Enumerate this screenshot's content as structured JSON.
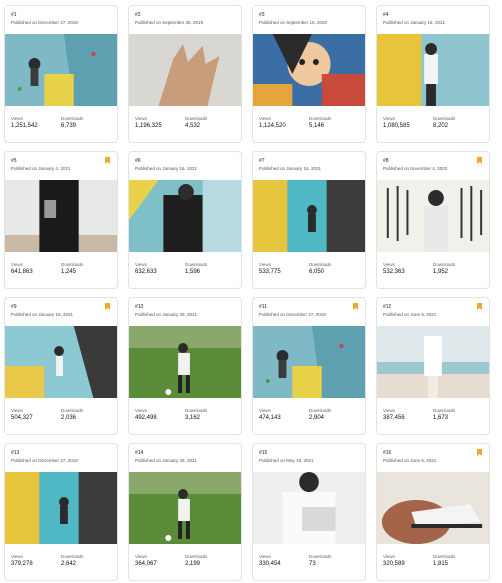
{
  "labels": {
    "views": "Views",
    "downloads": "Downloads"
  },
  "colors": {
    "bookmark": "#f0a92c",
    "border": "#e3e3e3"
  },
  "cards": [
    {
      "rank": "#1",
      "published": "Published on December 27, 2019",
      "views": "1,251,542",
      "downloads": "6,739",
      "bookmarked": false,
      "photo": "climbing-wall"
    },
    {
      "rank": "#2",
      "published": "Published on September 30, 2019",
      "views": "1,196,325",
      "downloads": "4,532",
      "bookmarked": false,
      "photo": "hand"
    },
    {
      "rank": "#3",
      "published": "Published on September 10, 2020",
      "views": "1,124,520",
      "downloads": "5,146",
      "bookmarked": false,
      "photo": "mural"
    },
    {
      "rank": "#4",
      "published": "Published on January 16, 2021",
      "views": "1,080,585",
      "downloads": "8,202",
      "bookmarked": false,
      "photo": "climber-yellow"
    },
    {
      "rank": "#5",
      "published": "Published on January 4, 2021",
      "views": "641,863",
      "downloads": "1,245",
      "bookmarked": true,
      "photo": "person-black"
    },
    {
      "rank": "#6",
      "published": "Published on January 16, 2021",
      "views": "632,633",
      "downloads": "1,596",
      "bookmarked": false,
      "photo": "climber-harness"
    },
    {
      "rank": "#7",
      "published": "Published on January 16, 2021",
      "views": "533,775",
      "downloads": "6,050",
      "bookmarked": false,
      "photo": "climber-teal"
    },
    {
      "rank": "#8",
      "published": "Published on November 4, 2020",
      "views": "532,363",
      "downloads": "1,952",
      "bookmarked": true,
      "photo": "calligraphy"
    },
    {
      "rank": "#9",
      "published": "Published on January 16, 2021",
      "views": "504,327",
      "downloads": "2,036",
      "bookmarked": true,
      "photo": "climber-reach"
    },
    {
      "rank": "#10",
      "published": "Published on January 28, 2021",
      "views": "492,498",
      "downloads": "3,162",
      "bookmarked": false,
      "photo": "soccer"
    },
    {
      "rank": "#11",
      "published": "Published on December 27, 2019",
      "views": "474,143",
      "downloads": "2,904",
      "bookmarked": true,
      "photo": "climbing-wall"
    },
    {
      "rank": "#12",
      "published": "Published on June 9, 2021",
      "views": "387,456",
      "downloads": "1,673",
      "bookmarked": true,
      "photo": "beach"
    },
    {
      "rank": "#13",
      "published": "Published on December 27, 2019",
      "views": "379,278",
      "downloads": "2,642",
      "bookmarked": false,
      "photo": "climber-teal"
    },
    {
      "rank": "#14",
      "published": "Published on January 28, 2021",
      "views": "364,067",
      "downloads": "2,199",
      "bookmarked": false,
      "photo": "soccer"
    },
    {
      "rank": "#15",
      "published": "Published on May 18, 2021",
      "views": "330,454",
      "downloads": "73",
      "bookmarked": false,
      "photo": "person-white"
    },
    {
      "rank": "#16",
      "published": "Published on June 9, 2021",
      "views": "320,589",
      "downloads": "1,815",
      "bookmarked": true,
      "photo": "sneaker"
    }
  ]
}
